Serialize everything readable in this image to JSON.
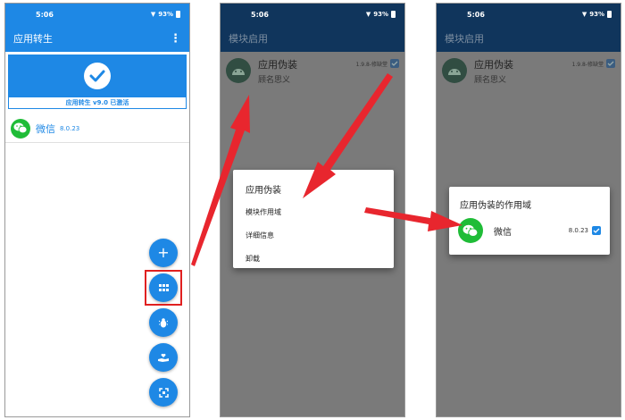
{
  "colors": {
    "accent": "#1e88e5",
    "wechat_green": "#1fbc37",
    "arrow_red": "#e8262e",
    "scrim": "#7a7a7a"
  },
  "status": {
    "time": "5:06",
    "battery": "93%"
  },
  "panel1": {
    "title": "应用转生",
    "banner_caption": "应用转生 v9.0 已激活",
    "app": {
      "name": "微信",
      "version": "8.0.23",
      "icon": "wechat-icon"
    },
    "fabs": [
      "add-icon",
      "apps-grid-icon",
      "bug-icon",
      "hands-heart-icon",
      "expand-icon"
    ]
  },
  "panel2": {
    "title": "模块启用",
    "module": {
      "name": "应用伪装",
      "desc": "顾名思义",
      "version": "1.9.8-修缺堂",
      "checked": true
    },
    "dialog": {
      "title": "应用伪装",
      "items": [
        "模块作用域",
        "详细信息",
        "卸载"
      ]
    }
  },
  "panel3": {
    "title": "模块启用",
    "module": {
      "name": "应用伪装",
      "desc": "顾名思义",
      "version": "1.9.8-修缺堂",
      "checked": true
    },
    "dialog": {
      "title": "应用伪装的作用域",
      "app": {
        "name": "微信",
        "version": "8.0.23",
        "checked": true
      }
    }
  }
}
